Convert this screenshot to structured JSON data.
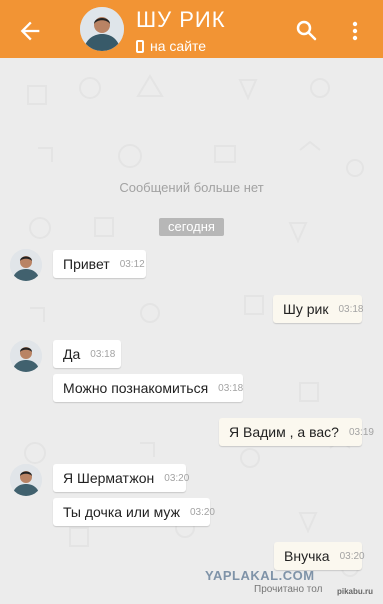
{
  "header": {
    "title": "ШУ РИК",
    "status": "на сайте",
    "back_icon": "arrow-left-icon",
    "search_icon": "search-icon",
    "more_icon": "more-vert-icon",
    "color": "#f29434"
  },
  "chat": {
    "empty_note": "Сообщений больше нет",
    "date_badge": "сегодня",
    "messages": [
      {
        "text": "Привет",
        "time": "03:12",
        "direction": "in"
      },
      {
        "text": "Шу рик",
        "time": "03:18",
        "direction": "out"
      },
      {
        "text": "Да",
        "time": "03:18",
        "direction": "in"
      },
      {
        "text": "Можно познакомиться",
        "time": "03:18",
        "direction": "in"
      },
      {
        "text": "Я Вадим , а вас?",
        "time": "03:19",
        "direction": "out"
      },
      {
        "text": "Я Шерматжон",
        "time": "03:20",
        "direction": "in"
      },
      {
        "text": "Ты дочка или муж",
        "time": "03:20",
        "direction": "in"
      },
      {
        "text": "Внучка",
        "time": "03:20",
        "direction": "out"
      }
    ]
  },
  "footer": {
    "watermark": "YAPLAKAL.COM",
    "source": "Прочитано тол",
    "source_tag": "pikabu.ru"
  }
}
